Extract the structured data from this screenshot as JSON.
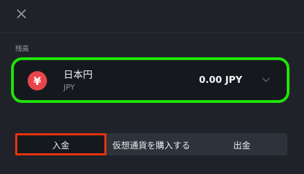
{
  "section_label": "残高",
  "account": {
    "currency_name": "日本円",
    "currency_code": "JPY",
    "icon_symbol": "¥",
    "icon": "yen-icon",
    "balance": "0.00 JPY"
  },
  "actions": {
    "deposit_label": "入金",
    "buy_crypto_label": "仮想通貨を購入する",
    "withdraw_label": "出金"
  },
  "colors": {
    "background": "#1f2329",
    "card": "#15191e",
    "highlight_green": "#20e40a",
    "highlight_red": "#f0320e",
    "yen_icon": "#e8454a"
  }
}
